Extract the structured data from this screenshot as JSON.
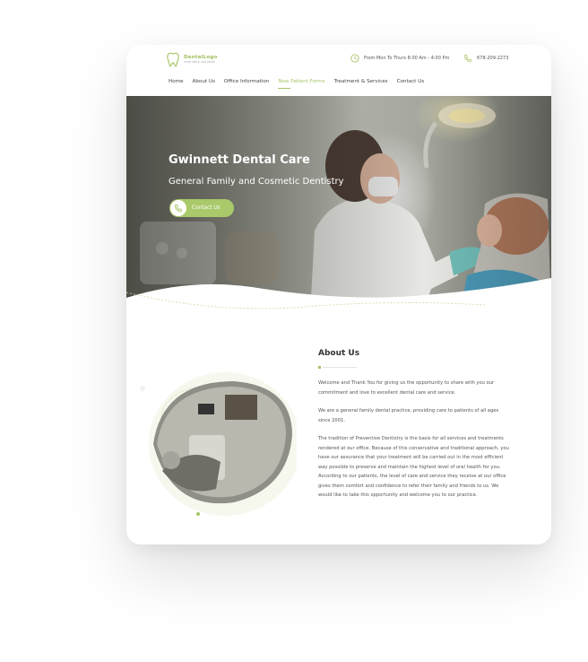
{
  "logo": {
    "name": "DentalLogo",
    "tagline": "YOUR SMILE OUR PRIDE"
  },
  "header": {
    "hours": "From Mon To Thurs 8:00 Am - 4:00 Pm",
    "phone": "678-209-2273"
  },
  "nav": {
    "items": [
      {
        "label": "Home",
        "active": false
      },
      {
        "label": "About Us",
        "active": false
      },
      {
        "label": "Office Information",
        "active": false
      },
      {
        "label": "New Patient Forms",
        "active": true
      },
      {
        "label": "Treatment & Services",
        "active": false
      },
      {
        "label": "Contact Us",
        "active": false
      }
    ]
  },
  "hero": {
    "title": "Gwinnett Dental Care",
    "subtitle": "General Family and Cosmetic Dentistry",
    "button_label": "Contact Us"
  },
  "about": {
    "title": "About Us",
    "paragraphs": [
      "Welcome and Thank You for giving us the opportunity to share with you our commitment and love to excellent dental care and service.",
      "We are a general family dental practice, providing care to patients of all ages since 2001.",
      "The tradition of Preventive Dentistry is the basis for all services and treatments rendered at our office. Because of this conservative and traditional approach, you have our assurance that your treatment will be carried out in the most efficient way possible to preserve and maintain the highest level of oral health for you. According to our patients, the level of care and service they receive at our office gives them comfort and confidence to refer their family and friends to us. We would like to take this opportunity and welcome you to our practice."
    ]
  },
  "colors": {
    "accent": "#a7c567",
    "button": "#a9c96a",
    "text": "#444444"
  }
}
